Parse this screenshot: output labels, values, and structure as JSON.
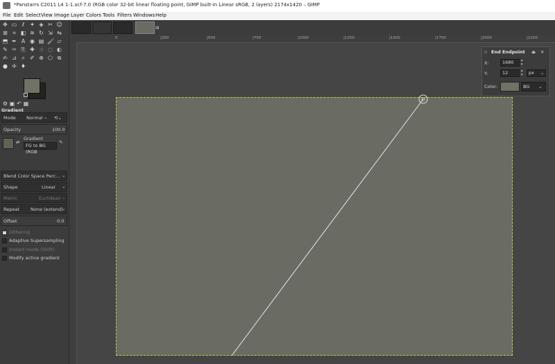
{
  "window": {
    "title": "*Panstarrs C2011 L4 1-1.xcf-7.0 (RGB color 32-bit linear floating point, GIMP built-in Linear sRGB, 2 layers) 2174x1420 – GIMP"
  },
  "menubar": [
    "File",
    "Edit",
    "Select",
    "View",
    "Image",
    "Layer",
    "Colors",
    "Tools",
    "Filters",
    "Windows",
    "Help"
  ],
  "tool_options": {
    "title": "Gradient",
    "mode_label": "Mode",
    "mode_value": "Normal",
    "opacity_label": "Opacity",
    "opacity_value": "100.0",
    "gradient_label": "Gradient",
    "gradient_value": "FG to BG (RGB",
    "blend_space": "Blend Color Space Perc...",
    "shape_label": "Shape",
    "shape_value": "Linear",
    "metric_label": "Metric",
    "metric_value": "Euclidean",
    "repeat_label": "Repeat",
    "repeat_value": "None (extend)",
    "offset_label": "Offset",
    "offset_value": "0.0",
    "dithering": "Dithering",
    "adaptive": "Adaptive Supersampling",
    "instant": "Instant mode  (Shift)",
    "modify": "Modify active gradient"
  },
  "ruler": {
    "h_labels": [
      "0",
      "|250",
      "|500",
      "|750",
      "|1000",
      "|1250",
      "|1500",
      "|1750",
      "|2000",
      "|2250"
    ]
  },
  "end_endpoint": {
    "title": "End Endpoint",
    "x_label": "X:",
    "x_value": "1680",
    "y_label": "Y:",
    "y_value": "12",
    "unit": "px",
    "color_label": "Color:",
    "color_value": "BG"
  },
  "colors": {
    "canvas_fill": "#6a6b62",
    "fg_swatch": "#6f7366",
    "bg_swatch": "#23241f"
  }
}
